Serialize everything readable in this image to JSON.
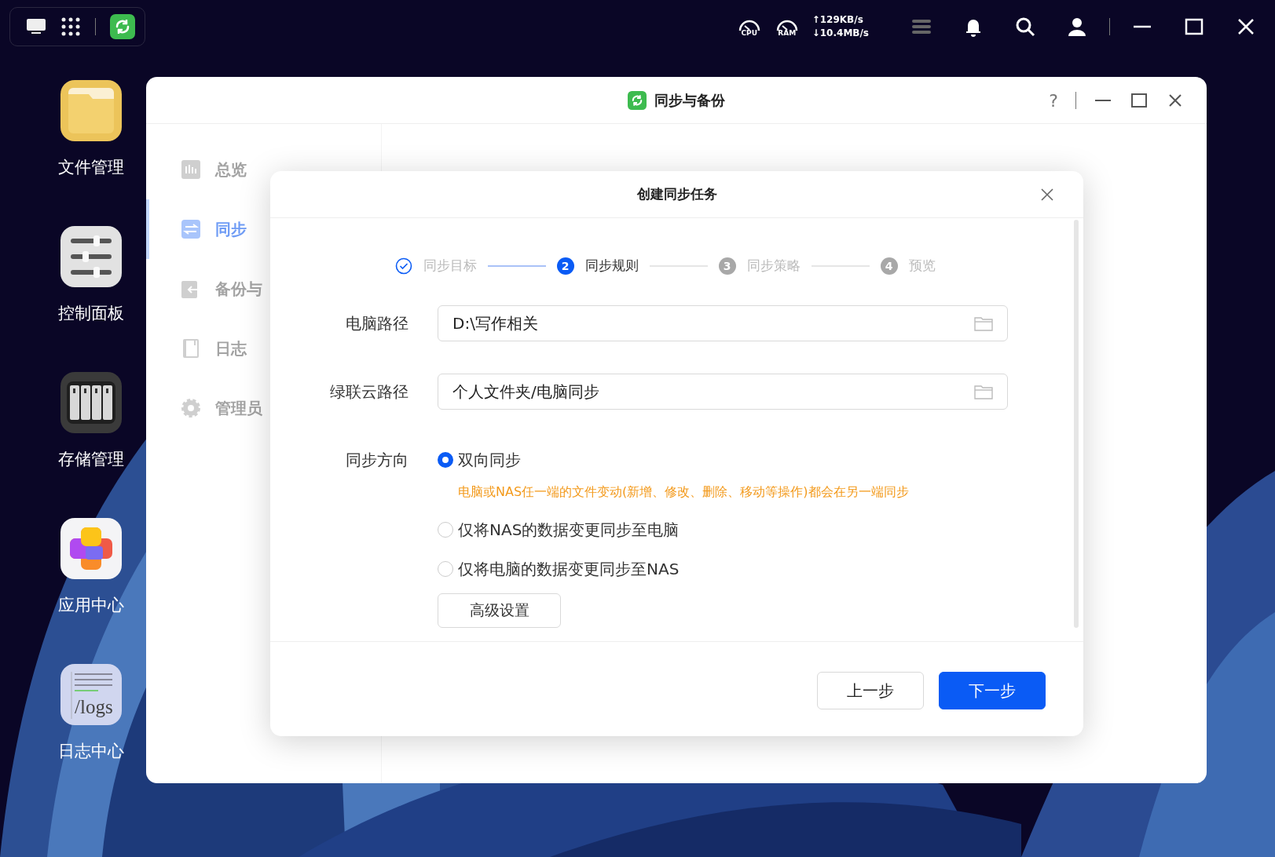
{
  "top_bar": {
    "cpu_label": "CPU",
    "ram_label": "RAM",
    "upload_speed": "↑129KB/s",
    "download_speed": "↓10.4MB/s"
  },
  "desktop_icons": [
    {
      "label": "文件管理",
      "kind": "files"
    },
    {
      "label": "控制面板",
      "kind": "control"
    },
    {
      "label": "存储管理",
      "kind": "storage"
    },
    {
      "label": "应用中心",
      "kind": "apps"
    },
    {
      "label": "日志中心",
      "kind": "logs",
      "icon_text": "/logs"
    }
  ],
  "window": {
    "title": "同步与备份",
    "help": "?"
  },
  "sidebar": [
    {
      "label": "总览",
      "kind": "overview",
      "selected": false
    },
    {
      "label": "同步",
      "kind": "sync",
      "selected": true
    },
    {
      "label": "备份与",
      "kind": "backup",
      "selected": false
    },
    {
      "label": "日志",
      "kind": "log",
      "selected": false
    },
    {
      "label": "管理员",
      "kind": "admin",
      "selected": false
    }
  ],
  "dialog": {
    "title": "创建同步任务",
    "steps": [
      {
        "label": "同步目标",
        "done": true,
        "current": false
      },
      {
        "label": "同步规则",
        "done": false,
        "current": true,
        "number": "2"
      },
      {
        "label": "同步策略",
        "done": false,
        "current": false,
        "number": "3"
      },
      {
        "label": "预览",
        "done": false,
        "current": false,
        "number": "4"
      }
    ],
    "fields": [
      {
        "label": "电脑路径",
        "value": "D:\\写作相关"
      },
      {
        "label": "绿联云路径",
        "value": "个人文件夹/电脑同步"
      }
    ],
    "direction": {
      "label": "同步方向",
      "options": [
        {
          "label": "双向同步",
          "selected": true,
          "hint": "电脑或NAS任一端的文件变动(新增、修改、删除、移动等操作)都会在另一端同步"
        },
        {
          "label": "仅将NAS的数据变更同步至电脑",
          "selected": false
        },
        {
          "label": "仅将电脑的数据变更同步至NAS",
          "selected": false
        }
      ]
    },
    "advanced_button": "高级设置",
    "buttons": [
      {
        "label": "上一步",
        "kind": "secondary"
      },
      {
        "label": "下一步",
        "kind": "primary"
      }
    ]
  }
}
